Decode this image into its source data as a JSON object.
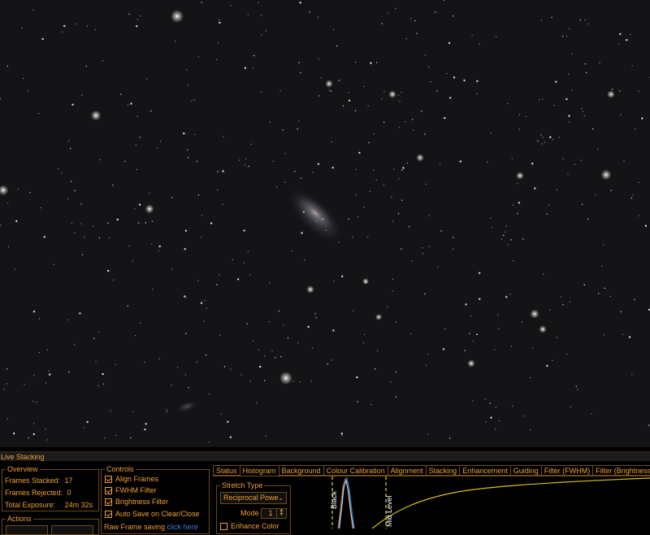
{
  "image": {
    "kind": "astronomy-live-stack-view",
    "background_color": "#141416"
  },
  "panel": {
    "title": "Live Stacking",
    "accent_color": "#f0a030",
    "link_color": "#3b7bd6",
    "overview": {
      "title": "Overview",
      "rows": [
        {
          "label": "Frames Stacked:",
          "value": "17"
        },
        {
          "label": "Frames Rejected:",
          "value": "0"
        },
        {
          "label": "Total Exposure:",
          "value": "24m 32s"
        }
      ]
    },
    "actions": {
      "title": "Actions"
    },
    "controls": {
      "title": "Controls",
      "items": [
        {
          "label": "Align Frames",
          "checked": true
        },
        {
          "label": "FWHM Filter",
          "checked": true
        },
        {
          "label": "Brightness Filter",
          "checked": true
        },
        {
          "label": "Auto Save on Clear/Close",
          "checked": true
        }
      ],
      "raw_saving_label": "Raw Frame saving",
      "raw_saving_link": "click here"
    },
    "tabs": [
      {
        "label": "Status",
        "active": false
      },
      {
        "label": "Histogram",
        "active": true
      },
      {
        "label": "Background",
        "active": false
      },
      {
        "label": "Colour Calibration",
        "active": false
      },
      {
        "label": "Alignment",
        "active": false
      },
      {
        "label": "Stacking",
        "active": false
      },
      {
        "label": "Enhancement",
        "active": false
      },
      {
        "label": "Guiding",
        "active": false
      },
      {
        "label": "Filter (FWHM)",
        "active": false
      },
      {
        "label": "Filter (Brightness)",
        "active": false
      }
    ],
    "stretch": {
      "title": "Stretch Type",
      "selected": "Reciprocal Power",
      "mode_label": "Mode",
      "mode_value": "1",
      "enhance_color_label": "Enhance Color",
      "enhance_color_checked": false
    },
    "histogram": {
      "black_label": "Black",
      "mid_label": "Mid Level",
      "curve_color": "#d8c020",
      "channel_colors": [
        "#d04030",
        "#3aa040",
        "#3070d0",
        "#e0e0e0"
      ]
    }
  }
}
